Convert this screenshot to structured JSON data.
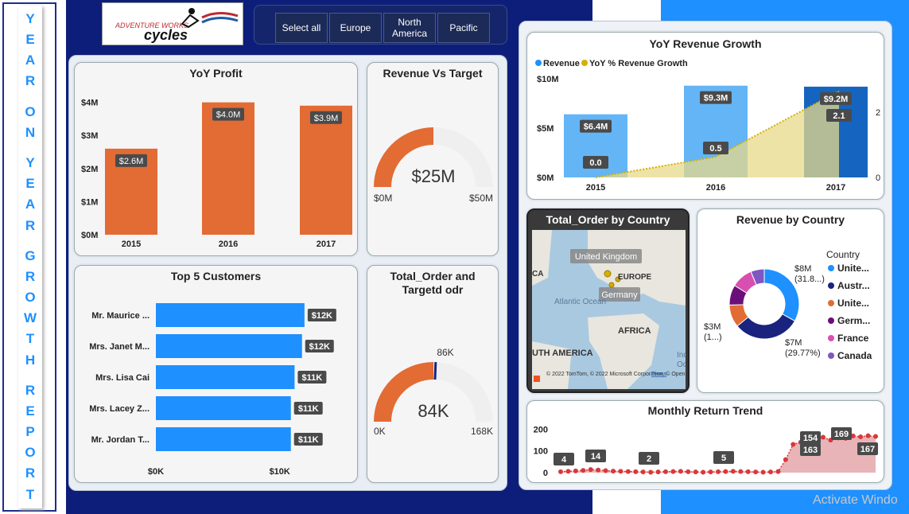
{
  "report_title_letters": [
    "Y",
    "E",
    "A",
    "R",
    "",
    "O",
    "N",
    "",
    "Y",
    "E",
    "A",
    "R",
    "",
    "G",
    "R",
    "O",
    "W",
    "T",
    "H",
    "",
    "R",
    "E",
    "P",
    "O",
    "R",
    "T"
  ],
  "logo": {
    "line1": "ADVENTURE WORKS",
    "line2": "cycles"
  },
  "slicer": {
    "buttons": [
      {
        "label": "Select all"
      },
      {
        "label": "Europe"
      },
      {
        "label": "North America"
      },
      {
        "label": "Pacific"
      }
    ]
  },
  "colors": {
    "orange": "#e36b34",
    "blue": "#1e90ff",
    "navy": "#0d1e7a",
    "gold": "#d4b000",
    "pink": "#e8b4b8",
    "red_dot": "#d9383a"
  },
  "yoy_profit": {
    "title": "YoY Profit",
    "chart_data": {
      "type": "bar",
      "categories": [
        "2015",
        "2016",
        "2017"
      ],
      "values": [
        2.6,
        4.0,
        3.9
      ],
      "labels": [
        "$2.6M",
        "$4.0M",
        "$3.9M"
      ],
      "yticks": [
        "$0M",
        "$1M",
        "$2M",
        "$3M",
        "$4M"
      ],
      "ylim": [
        0,
        4.4
      ]
    }
  },
  "revenue_vs_target": {
    "title": "Revenue Vs Target",
    "value_label": "$25M",
    "min_label": "$0M",
    "max_label": "$50M",
    "value": 25,
    "max": 50
  },
  "top_customers": {
    "title": "Top 5 Customers",
    "chart_data": {
      "type": "bar",
      "categories": [
        "Mr. Maurice ...",
        "Mrs. Janet M...",
        "Mrs. Lisa Cai",
        "Mrs. Lacey Z...",
        "Mr. Jordan T..."
      ],
      "values": [
        12.0,
        11.8,
        11.2,
        10.9,
        10.9
      ],
      "labels": [
        "$12K",
        "$12K",
        "$11K",
        "$11K",
        "$11K"
      ],
      "xticks": [
        "$0K",
        "$10K"
      ],
      "xlim": [
        0,
        14
      ]
    }
  },
  "total_order": {
    "title": "Total_Order and Targetd odr",
    "value_label": "84K",
    "target_label": "86K",
    "min_label": "0K",
    "max_label": "168K",
    "value": 84,
    "target": 86,
    "max": 168
  },
  "yoy_revenue": {
    "title": "YoY Revenue Growth",
    "legend": [
      "Revenue",
      "YoY % Revenue Growth"
    ],
    "chart_data": {
      "type": "bar",
      "categories": [
        "2015",
        "2016",
        "2017"
      ],
      "series": [
        {
          "name": "Revenue",
          "values": [
            6.4,
            9.3,
            9.2
          ],
          "labels": [
            "$6.4M",
            "$9.3M",
            "$9.2M"
          ]
        },
        {
          "name": "YoY % Revenue Growth",
          "values": [
            0.0,
            0.5,
            2.1
          ],
          "labels": [
            "0.0",
            "0.5",
            "2.1"
          ]
        }
      ],
      "yticks_left": [
        "$0M",
        "$5M",
        "$10M"
      ],
      "yticks_right": [
        "0",
        "2"
      ]
    }
  },
  "map": {
    "title": "Total_Order by Country",
    "labels": {
      "uk": "United Kingdom",
      "germany": "Germany",
      "europe": "EUROPE",
      "atlantic": "Atlantic Ocean",
      "africa": "AFRICA",
      "south_america": "UTH AMERICA",
      "ca": "CA",
      "ind": "Ind",
      "oc": "Oc"
    },
    "attribution": "© 2022 TomTom, © 2022 Microsoft Corporation, © OpenStreetMap",
    "terms": "Terms"
  },
  "revenue_by_country": {
    "title": "Revenue by Country",
    "legend_title": "Country",
    "chart_data": {
      "type": "pie",
      "categories": [
        "Unite...",
        "Austr...",
        "Unite...",
        "Germ...",
        "France",
        "Canada"
      ],
      "values": [
        31.8,
        29.77,
        10.0,
        9.0,
        9.5,
        6.0
      ],
      "colors": [
        "#1e90ff",
        "#1a237e",
        "#e36b34",
        "#6a0f7a",
        "#d94fb0",
        "#7e57c2"
      ]
    },
    "callouts": {
      "top": "$8M",
      "top_sub": "(31.8...)",
      "left": "$3M",
      "left_sub": "(1...)",
      "bottom": "$7M",
      "bottom_sub": "(29.77%)"
    }
  },
  "monthly_return": {
    "title": "Monthly Return Trend",
    "yticks": [
      "0",
      "100",
      "200"
    ],
    "chart_data": {
      "type": "area",
      "values": [
        4,
        6,
        8,
        10,
        14,
        12,
        9,
        7,
        6,
        5,
        4,
        3,
        2,
        3,
        4,
        5,
        6,
        4,
        3,
        2,
        3,
        4,
        5,
        6,
        5,
        4,
        3,
        2,
        3,
        5,
        60,
        130,
        140,
        150,
        154,
        163,
        150,
        160,
        158,
        169,
        165,
        170,
        167
      ],
      "ylim": [
        0,
        220
      ]
    },
    "point_labels": [
      "4",
      "14",
      "2",
      "5",
      "154",
      "163",
      "169",
      "167"
    ]
  },
  "watermark": "Activate Windo"
}
